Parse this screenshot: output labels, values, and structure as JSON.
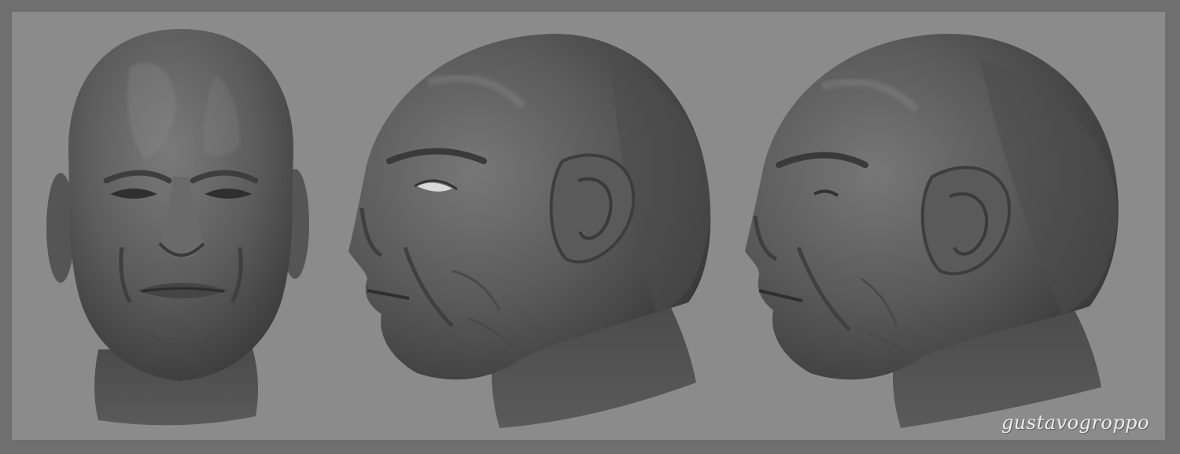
{
  "image": {
    "background_color": "#6f6f6f",
    "panel_color": "#8b8b8b",
    "views": [
      {
        "name": "front-view"
      },
      {
        "name": "three-quarter-view"
      },
      {
        "name": "side-view"
      }
    ]
  },
  "watermark": {
    "text": "gustavogroppo"
  }
}
